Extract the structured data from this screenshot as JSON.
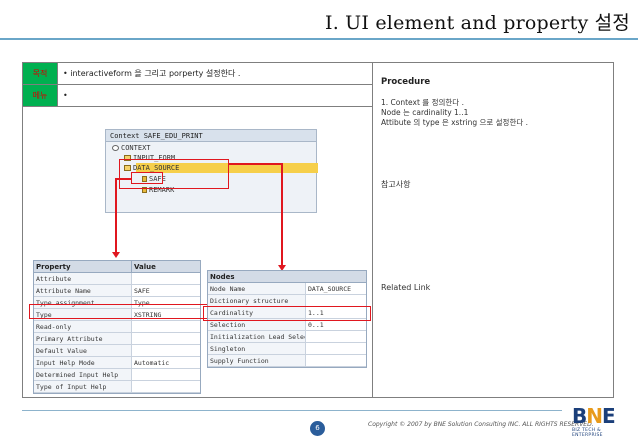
{
  "header": {
    "title": "I. UI element and property  설정"
  },
  "left": {
    "row1": {
      "tag": "목적",
      "text": "• interactiveform 을 그리고  porperty 설정한다 ."
    },
    "row2": {
      "tag": "메뉴",
      "text": "•"
    }
  },
  "tree": {
    "header": "Context SAFE_EDU_PRINT",
    "nodes": [
      "CONTEXT",
      "INPUT_FORM",
      "DATA_SOURCE",
      "SAFE",
      "REMARK"
    ]
  },
  "attr_table": {
    "headers": [
      "Property",
      "Value"
    ],
    "rows": [
      [
        "Attribute",
        ""
      ],
      [
        "Attribute Name",
        "SAFE"
      ],
      [
        "Type assignment",
        "Type"
      ],
      [
        "Type",
        "XSTRING"
      ],
      [
        "Read-only",
        ""
      ],
      [
        "Primary Attribute",
        ""
      ],
      [
        "Default Value",
        ""
      ],
      [
        "Input Help Mode",
        "Automatic"
      ],
      [
        "Determined Input Help",
        ""
      ],
      [
        "Type of Input Help",
        ""
      ]
    ]
  },
  "node_table": {
    "headers": [
      "Nodes",
      ""
    ],
    "rows": [
      [
        "Node Name",
        "DATA_SOURCE"
      ],
      [
        "Dictionary structure",
        ""
      ],
      [
        "Cardinality",
        "1..1"
      ],
      [
        "Selection",
        "0..1"
      ],
      [
        "Initialization Lead Selection",
        ""
      ],
      [
        "Singleton",
        ""
      ],
      [
        "Supply Function",
        ""
      ]
    ]
  },
  "right": {
    "procedure_title": "Procedure",
    "lines": [
      "1. Context 를 정의한다 .",
      "Node 는  cardinality 1..1",
      "Attibute 의  type 은  xstring 으로 설정한다 ."
    ],
    "reference_label": "참고사항",
    "related_label": "Related Link"
  },
  "footer": {
    "page_number": "6",
    "copyright": "Copyright © 2007 by BNE Solution Consulting INC.   ALL RIGHTS RESERVED.",
    "logo_text": "BNE",
    "logo_sub": "BIZ TECH & ENTERPRISE"
  },
  "colors": {
    "tag_bg": "#00b050",
    "tag_text": "#d40000",
    "highlight": "#e0171f",
    "rule": "#6aa6c8"
  }
}
